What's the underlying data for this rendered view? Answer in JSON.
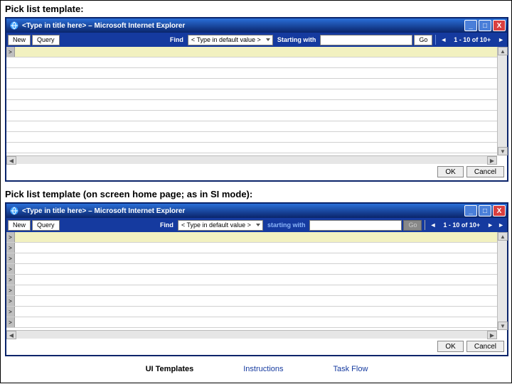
{
  "section1_label": "Pick list template:",
  "section2_label": "Pick list template (on screen home page; as in SI mode):",
  "win1": {
    "title": "<Type in title here> – Microsoft Internet Explorer",
    "toolbar": {
      "new": "New",
      "query": "Query",
      "find": "Find",
      "find_value": "< Type in default value >",
      "starting": "Starting with",
      "search_value": "",
      "go": "Go",
      "pager": "1 - 10 of 10+"
    },
    "rowExpand": ">",
    "ok": "OK",
    "cancel": "Cancel"
  },
  "win2": {
    "title": "<Type in title here> – Microsoft Internet Explorer",
    "toolbar": {
      "new": "New",
      "query": "Query",
      "find": "Find",
      "find_value": "< Type in default value >",
      "starting": "starting with",
      "search_value": "",
      "go": "Go",
      "pager": "1 - 10 of 10+"
    },
    "rowExpand": ">",
    "ok": "OK",
    "cancel": "Cancel"
  },
  "footer": {
    "tab1": "UI Templates",
    "tab2": "Instructions",
    "tab3": "Task Flow"
  },
  "icons": {
    "min": "_",
    "max": "□",
    "close": "X",
    "up": "▲",
    "down": "▼",
    "left": "◀",
    "right": "▶"
  }
}
